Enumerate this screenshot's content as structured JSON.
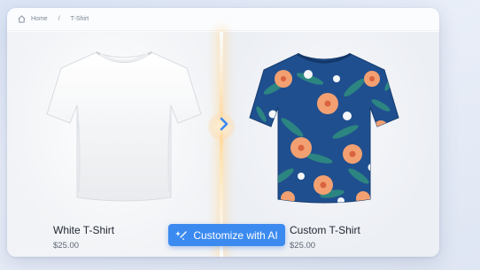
{
  "breadcrumb": {
    "home": "Home",
    "separator": "/",
    "current": "T-Shirt"
  },
  "products": {
    "original": {
      "name": "White T-Shirt",
      "price": "$25.00"
    },
    "custom": {
      "name": "Custom T-Shirt",
      "price": "$25.00"
    }
  },
  "action": {
    "customize_label": "Customize with AI"
  },
  "icons": {
    "home": "home-icon",
    "arrow": "chevron-right-icon",
    "wand": "sparkle-wand-icon"
  },
  "colors": {
    "accent": "#3b8af0",
    "shirt_base": "#1f4f8f"
  }
}
